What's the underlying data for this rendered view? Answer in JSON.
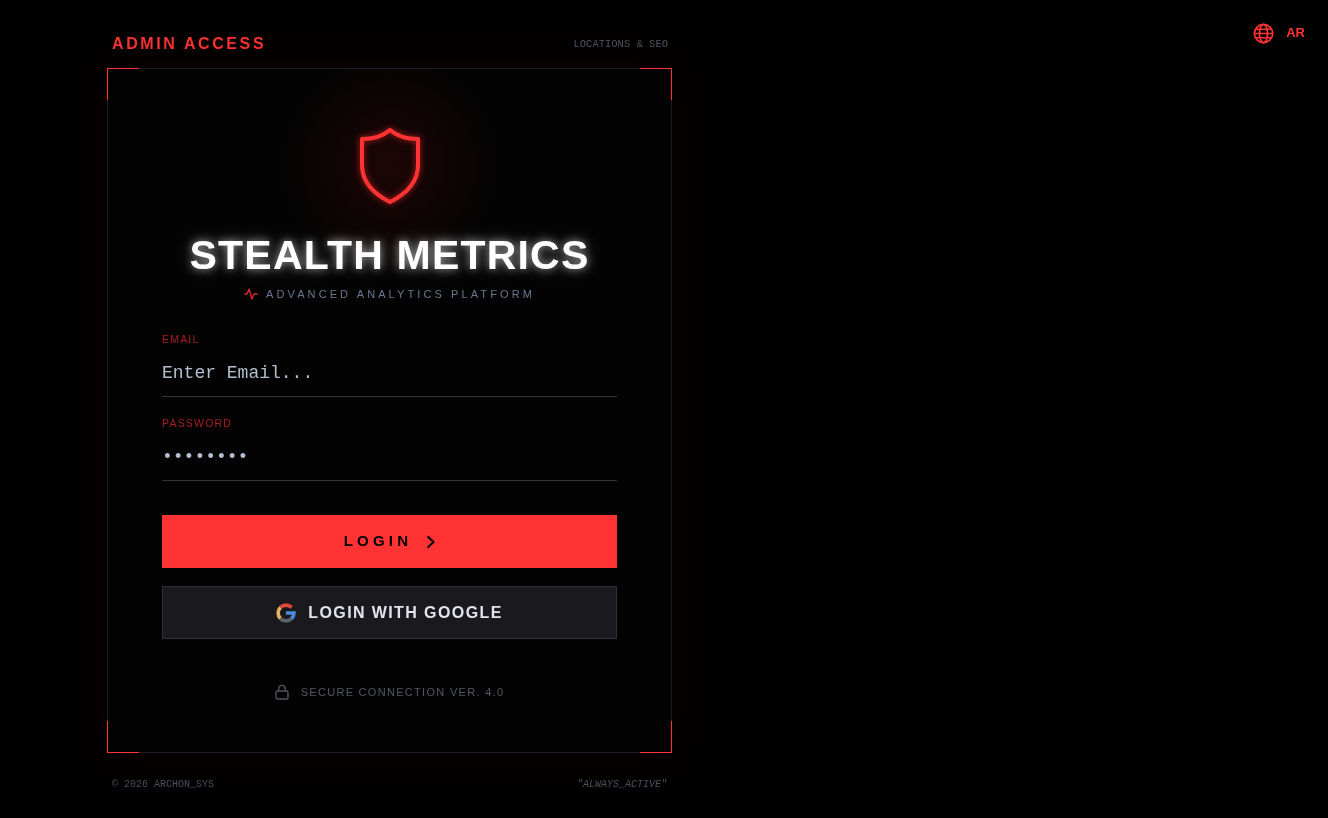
{
  "language_button": {
    "label": "AR"
  },
  "header": {
    "title": "ADMIN ACCESS",
    "subtitle": "LOCATIONS & SEO"
  },
  "brand": {
    "name": "STEALTH METRICS",
    "tagline": "ADVANCED ANALYTICS PLATFORM"
  },
  "form": {
    "fields": [
      {
        "label": "EMAIL",
        "placeholder": "Enter Email..."
      },
      {
        "label": "PASSWORD",
        "value": "••••••••"
      }
    ],
    "buttons": [
      {
        "kind": "primary",
        "label": "LOGIN"
      },
      {
        "kind": "google",
        "label": "LOGIN WITH GOOGLE"
      }
    ],
    "security_note": "SECURE CONNECTION VER. 4.0"
  },
  "footer": {
    "copyright": "© 2026 ARCHON_SYS",
    "motto": "\"ALWAYS_ACTIVE\""
  }
}
